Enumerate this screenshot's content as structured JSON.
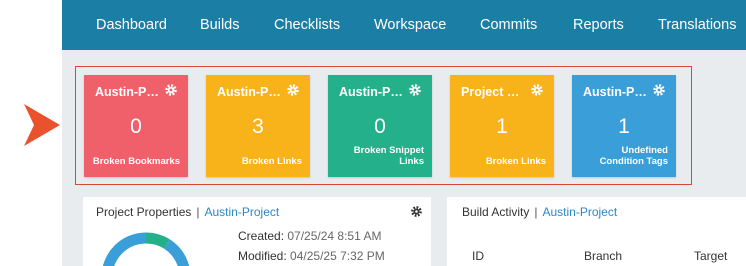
{
  "nav": {
    "tabs": [
      "Dashboard",
      "Builds",
      "Checklists",
      "Workspace",
      "Commits",
      "Reports",
      "Translations"
    ]
  },
  "tiles": [
    {
      "title": "Austin-Pr...",
      "count": "0",
      "label": "Broken Bookmarks",
      "color": "#f0606a"
    },
    {
      "title": "Austin-Pr...",
      "count": "3",
      "label": "Broken Links",
      "color": "#f8b21a"
    },
    {
      "title": "Austin-Pr...",
      "count": "0",
      "label": "Broken Snippet Links",
      "color": "#23b08a"
    },
    {
      "title": "Project O...",
      "count": "1",
      "label": "Broken Links",
      "color": "#f8b21a"
    },
    {
      "title": "Austin-Pr...",
      "count": "1",
      "label": "Undefined Condition Tags",
      "color": "#3a9ed9"
    }
  ],
  "project_properties": {
    "title": "Project Properties",
    "separator": "|",
    "project": "Austin-Project",
    "created_label": "Created:",
    "created_value": "07/25/24 8:51 AM",
    "modified_label": "Modified:",
    "modified_value": "04/25/25 7:32 PM"
  },
  "build_activity": {
    "title": "Build Activity",
    "separator": "|",
    "project": "Austin-Project",
    "columns": [
      "ID",
      "Branch",
      "Target"
    ]
  },
  "colors": {
    "nav_bg": "#1b7ea4",
    "highlight_border": "#d9472f",
    "callout_arrow": "#e9522c",
    "link": "#2a88c6"
  }
}
